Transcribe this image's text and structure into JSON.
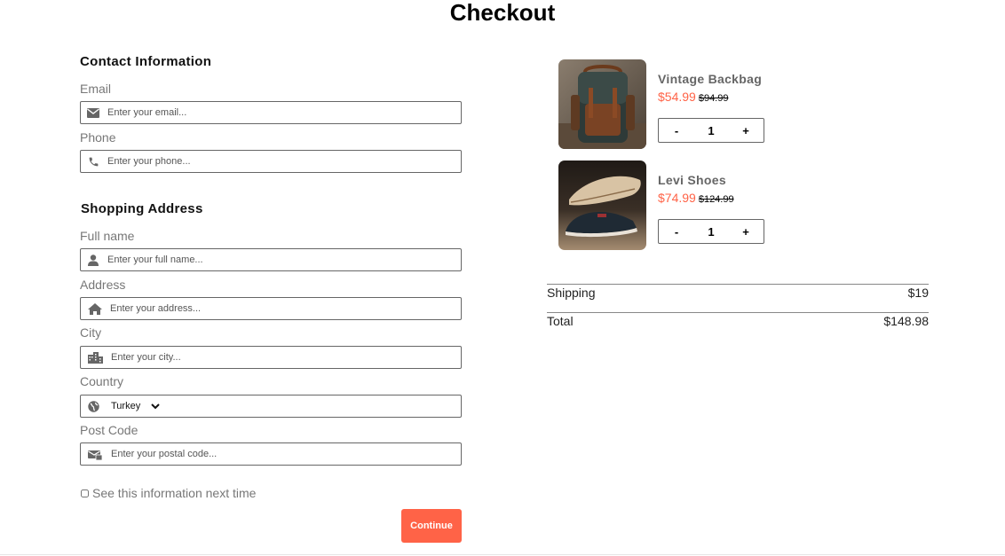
{
  "page": {
    "title": "Checkout"
  },
  "contact": {
    "title": "Contact Information",
    "email_label": "Email",
    "email_placeholder": "Enter your email...",
    "phone_label": "Phone",
    "phone_placeholder": "Enter your phone..."
  },
  "address": {
    "title": "Shopping Address",
    "fullname_label": "Full name",
    "fullname_placeholder": "Enter your full name...",
    "address_label": "Address",
    "address_placeholder": "Enter your address...",
    "city_label": "City",
    "city_placeholder": "Enter your city...",
    "country_label": "Country",
    "country_value": "Turkey",
    "postcode_label": "Post Code",
    "postcode_placeholder": "Enter your postal code..."
  },
  "form": {
    "remember_label": "See this information next time",
    "continue_label": "Continue"
  },
  "cart": {
    "items": [
      {
        "name": "Vintage Backbag",
        "price": "$54.99",
        "old_price": "$94.99",
        "qty": "1",
        "minus": "-",
        "plus": "+"
      },
      {
        "name": "Levi Shoes",
        "price": "$74.99",
        "old_price": "$124.99",
        "qty": "1",
        "minus": "-",
        "plus": "+"
      }
    ],
    "shipping_label": "Shipping",
    "shipping_value": "$19",
    "total_label": "Total",
    "total_value": "$148.98"
  },
  "colors": {
    "accent": "#ff6347"
  }
}
